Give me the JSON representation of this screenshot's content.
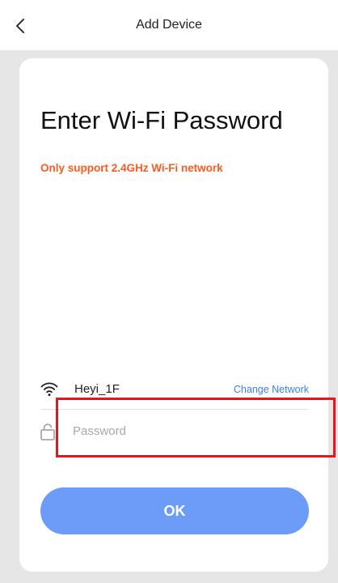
{
  "header": {
    "title": "Add Device",
    "back_icon": "chevron-left-icon"
  },
  "main": {
    "title": "Enter Wi-Fi Password",
    "notice": "Only support 2.4GHz Wi-Fi network",
    "notice_color": "#ff5a1f"
  },
  "wifi": {
    "icon": "wifi-icon",
    "network_name": "Heyi_1F",
    "change_label": "Change Network",
    "link_color": "#3a7ef2"
  },
  "password": {
    "icon": "lock-icon",
    "placeholder": "Password",
    "value": ""
  },
  "ok_button": {
    "label": "OK",
    "color": "#6b9cf7"
  },
  "highlight_color": "#e8141f"
}
